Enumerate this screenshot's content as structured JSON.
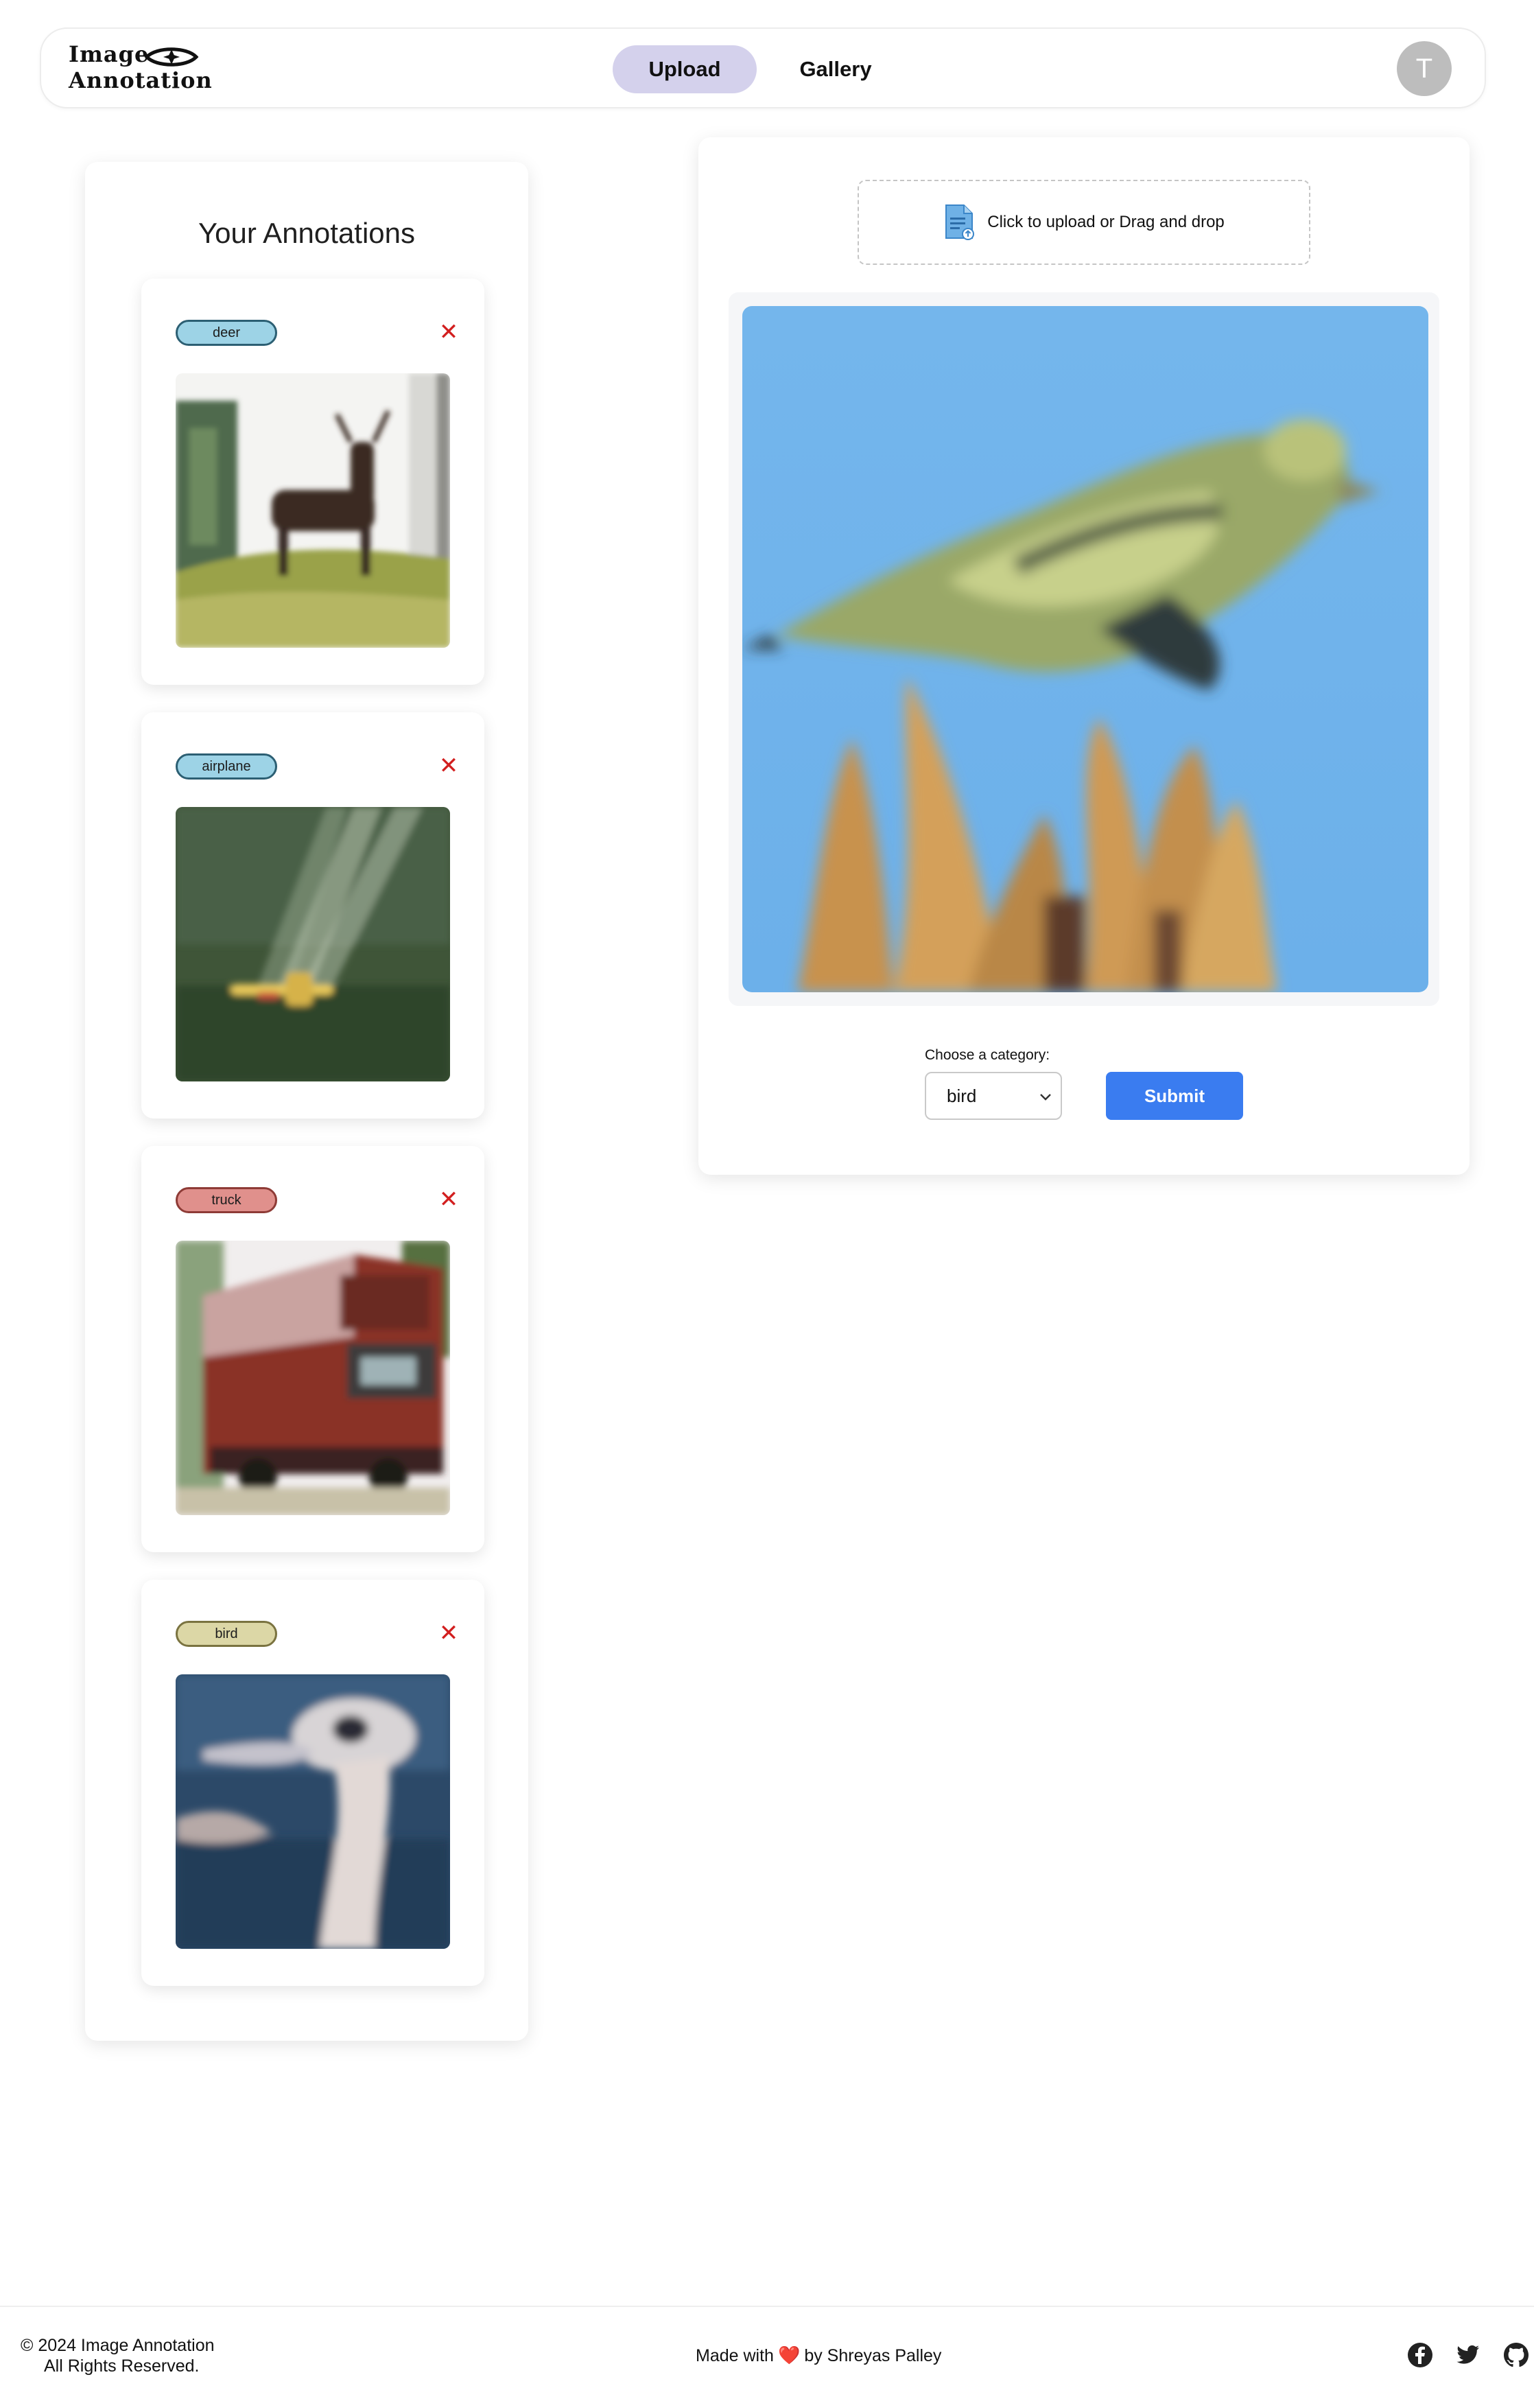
{
  "header": {
    "logo_line1": "Image",
    "logo_line2": "Annotation",
    "nav": {
      "upload": "Upload",
      "gallery": "Gallery"
    },
    "avatar_initial": "T"
  },
  "annotations": {
    "title": "Your Annotations",
    "items": [
      {
        "label": "deer",
        "tag_color": "#9dd3e6",
        "tag_border": "#2c5f73",
        "image": "deer-photo"
      },
      {
        "label": "airplane",
        "tag_color": "#9dd3e6",
        "tag_border": "#2c5f73",
        "image": "airplane-photo"
      },
      {
        "label": "truck",
        "tag_color": "#e0908c",
        "tag_border": "#8e3b36",
        "image": "truck-photo"
      },
      {
        "label": "bird",
        "tag_color": "#dcd7a6",
        "tag_border": "#7a7340",
        "image": "ostrich-photo"
      }
    ],
    "remove_glyph": "✕"
  },
  "upload": {
    "dropzone_text": "Click to upload or Drag and drop",
    "preview_image": "bird-photo",
    "category_label": "Choose a category:",
    "category_value": "bird",
    "submit_label": "Submit"
  },
  "footer": {
    "copyright": "© 2024 Image Annotation",
    "rights": "All Rights Reserved.",
    "made_with": "Made with",
    "made_heart": "❤️",
    "made_by": "by Shreyas Palley",
    "social": [
      "facebook-icon",
      "twitter-icon",
      "github-icon"
    ]
  },
  "colors": {
    "accent": "#3a7cf0",
    "nav_active": "#d4d1ec",
    "danger": "#d21f1f"
  }
}
